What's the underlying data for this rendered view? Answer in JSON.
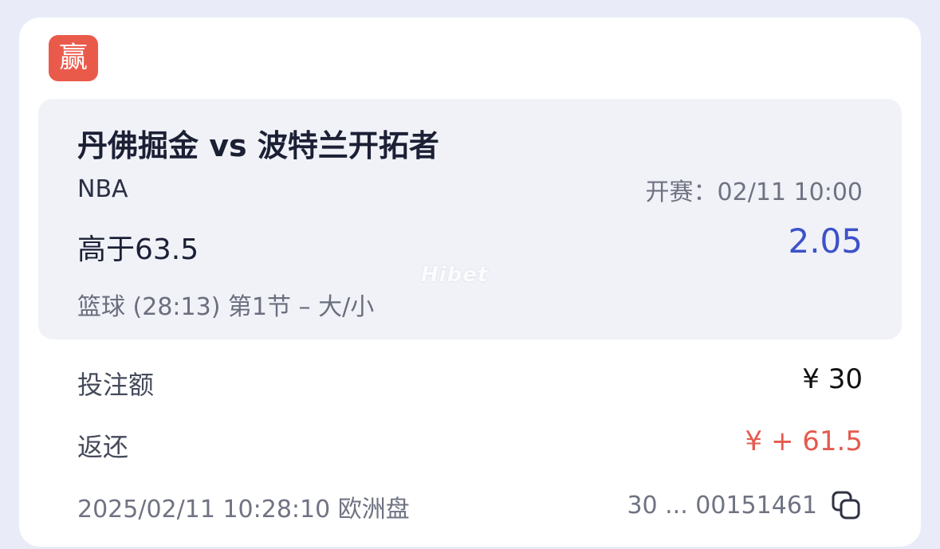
{
  "badge": {
    "label": "赢"
  },
  "match": {
    "title": "丹佛掘金 vs 波特兰开拓者",
    "league": "NBA",
    "kickoff": "开赛：02/11 10:00",
    "selection": "高于63.5",
    "odds": "2.05",
    "market": "篮球 (28:13) 第1节 – 大/小"
  },
  "watermark": "Hibet",
  "stake": {
    "label": "投注额",
    "value": "¥  30"
  },
  "return": {
    "label": "返还",
    "value": "¥  + 61.5"
  },
  "footer": {
    "placed": "2025/02/11 10:28:10 欧洲盘",
    "bet_id": "30 ... 00151461",
    "copy_icon": "copy-icon"
  },
  "colors": {
    "badge": "#ea5a4b",
    "odds": "#3d51c8",
    "return": "#e55a4e"
  }
}
